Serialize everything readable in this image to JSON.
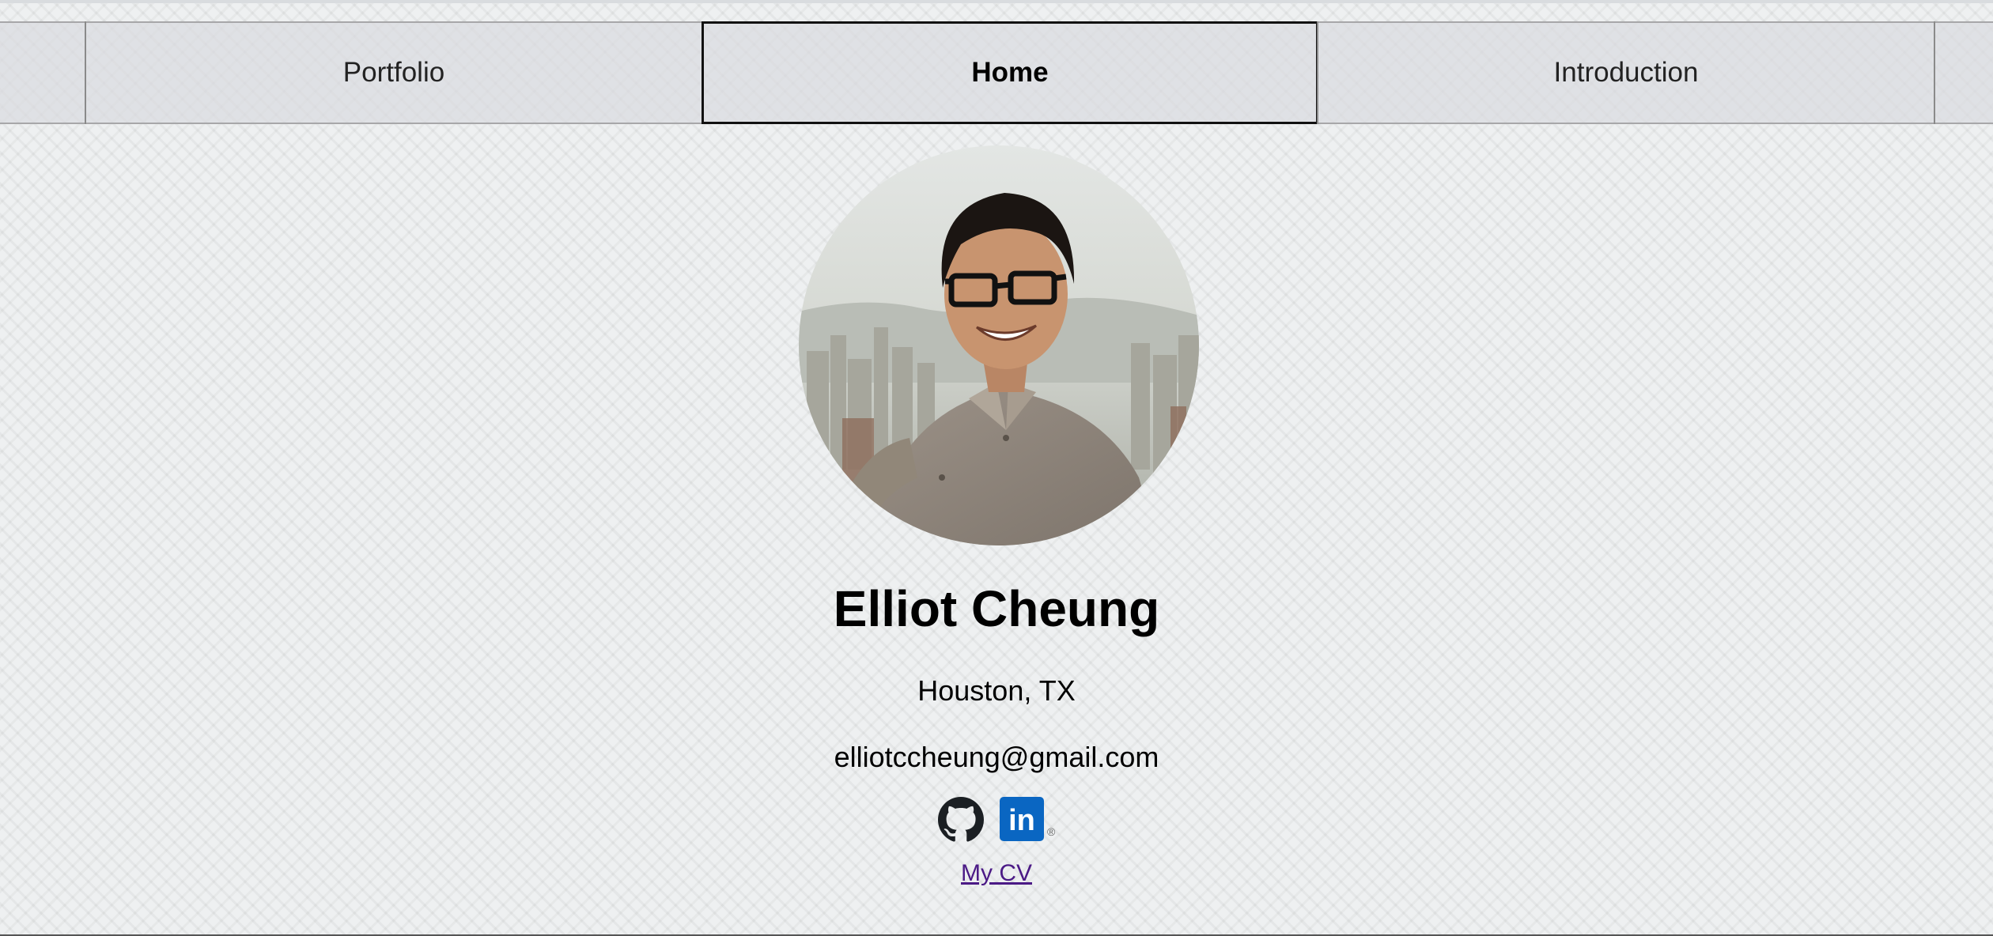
{
  "nav": {
    "tabs": [
      {
        "label": "Portfolio",
        "active": false
      },
      {
        "label": "Home",
        "active": true
      },
      {
        "label": "Introduction",
        "active": false
      }
    ]
  },
  "profile": {
    "name": "Elliot Cheung",
    "location": "Houston, TX",
    "email": "elliotccheung@gmail.com",
    "photo_icon": "profile-photo"
  },
  "social": {
    "github_icon": "github-icon",
    "linkedin_icon": "linkedin-icon",
    "linkedin_label": "in",
    "linkedin_registered_mark": "®"
  },
  "cv": {
    "label": "My CV"
  },
  "colors": {
    "link_visited": "#4b1a86",
    "linkedin_blue": "#0a66c2",
    "nav_border": "#8a8a8a",
    "active_border": "#111111"
  }
}
